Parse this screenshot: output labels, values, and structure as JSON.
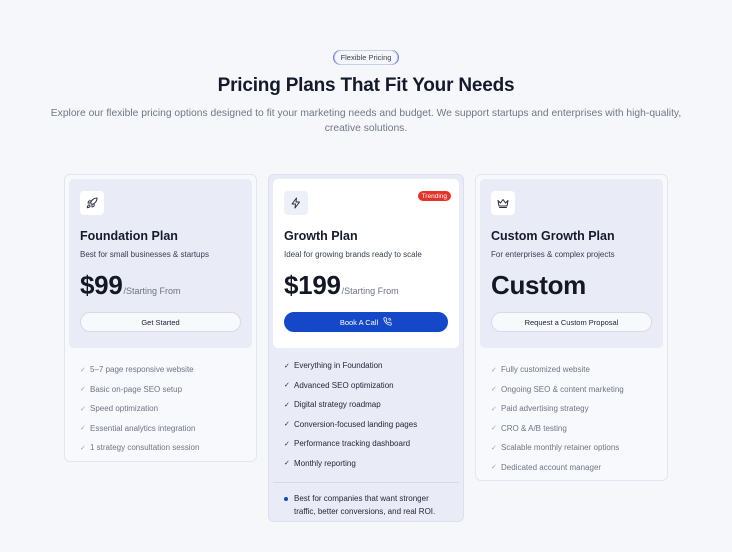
{
  "hero": {
    "pill": "Flexible Pricing",
    "title": "Pricing Plans That Fit Your Needs",
    "subtitle": "Explore our flexible pricing options designed to fit your marketing needs and budget. We support startups and enterprises with high-quality, creative solutions."
  },
  "plans": [
    {
      "icon": "rocket-icon",
      "name": "Foundation Plan",
      "desc": "Best for small businesses & startups",
      "price": "$99",
      "suffix": "/Starting From",
      "button": "Get Started",
      "features": [
        "5–7 page responsive website",
        "Basic on-page SEO setup",
        "Speed optimization",
        "Essential analytics integration",
        "1 strategy consultation session"
      ]
    },
    {
      "icon": "lightning-icon",
      "badge": "Trending",
      "name": "Growth Plan",
      "desc": "Ideal for growing brands ready to scale",
      "price": "$199",
      "suffix": "/Starting From",
      "button": "Book A Call",
      "features": [
        "Everything in Foundation",
        "Advanced SEO optimization",
        "Digital strategy roadmap",
        "Conversion-focused landing pages",
        "Performance tracking dashboard",
        "Monthly reporting"
      ],
      "note": "Best for companies that want stronger traffic, better conversions, and real ROI."
    },
    {
      "icon": "crown-icon",
      "name": "Custom Growth Plan",
      "desc": "For enterprises & complex projects",
      "price": "Custom",
      "button": "Request a Custom Proposal",
      "features": [
        "Fully customized website",
        "Ongoing SEO & content marketing",
        "Paid advertising strategy",
        "CRO & A/B testing",
        "Scalable monthly retainer options",
        "Dedicated account manager"
      ]
    }
  ],
  "colors": {
    "accent": "#1448c8",
    "badge": "#e5332a",
    "background": "#f6f7fb"
  },
  "check_glyph": "✓"
}
